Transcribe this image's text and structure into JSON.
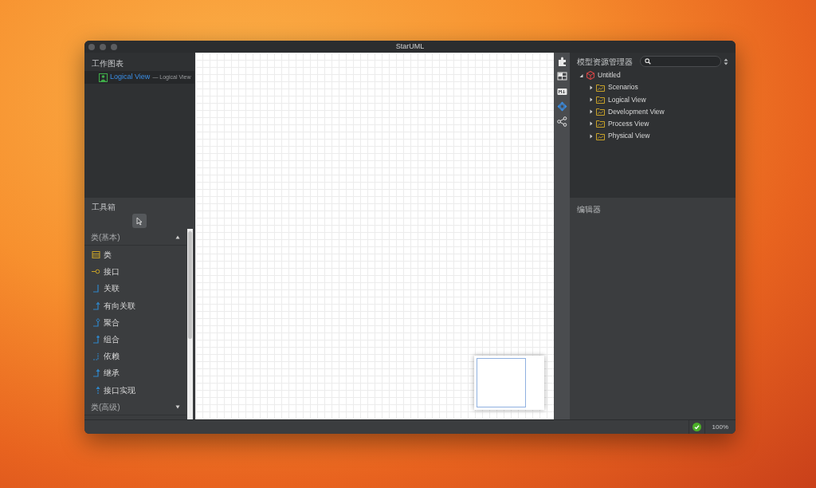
{
  "window": {
    "title": "StarUML"
  },
  "diagrams": {
    "title": "工作图表",
    "items": [
      {
        "label": "Logical View",
        "sublabel": "— Logical View",
        "selected": true
      }
    ]
  },
  "toolbox": {
    "title": "工具箱",
    "groups": [
      {
        "title": "类(基本)",
        "expanded": true,
        "items": [
          {
            "kind": "class",
            "label": "类"
          },
          {
            "kind": "interface",
            "label": "接口"
          },
          {
            "kind": "association",
            "label": "关联"
          },
          {
            "kind": "directed-association",
            "label": "有向关联"
          },
          {
            "kind": "aggregation",
            "label": "聚合"
          },
          {
            "kind": "composition",
            "label": "组合"
          },
          {
            "kind": "dependency",
            "label": "依赖"
          },
          {
            "kind": "generalization",
            "label": "继承"
          },
          {
            "kind": "realization",
            "label": "接口实现"
          }
        ]
      },
      {
        "title": "类(高级)",
        "expanded": false
      }
    ]
  },
  "side_tools": [
    {
      "kind": "extensions",
      "selected": false
    },
    {
      "kind": "layout",
      "selected": false
    },
    {
      "kind": "markdown",
      "selected": false
    },
    {
      "kind": "navigator",
      "selected": true
    },
    {
      "kind": "share",
      "selected": false
    }
  ],
  "model_explorer": {
    "title": "模型资源管理器",
    "tree": [
      {
        "label": "Untitled",
        "kind": "project",
        "expanded": true,
        "children": [
          {
            "label": "Scenarios",
            "kind": "folder",
            "expanded": false
          },
          {
            "label": "Logical View",
            "kind": "folder",
            "expanded": false
          },
          {
            "label": "Development View",
            "kind": "folder",
            "expanded": false
          },
          {
            "label": "Process View",
            "kind": "folder",
            "expanded": false
          },
          {
            "label": "Physical View",
            "kind": "folder",
            "expanded": false
          }
        ]
      }
    ]
  },
  "editor": {
    "title": "编辑器"
  },
  "status_bar": {
    "zoom": "100%"
  }
}
